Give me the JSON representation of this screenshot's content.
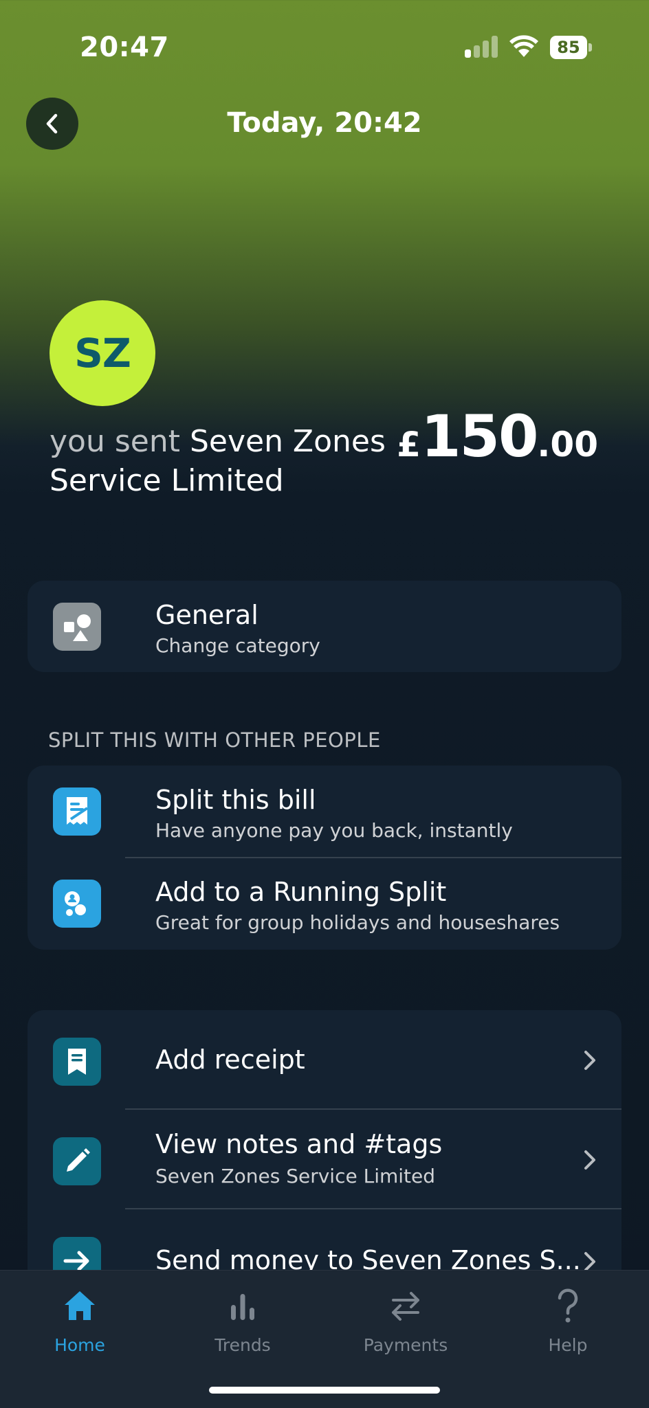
{
  "status_bar": {
    "time": "20:47",
    "battery": "85"
  },
  "header": {
    "title": "Today, 20:42"
  },
  "merchant": {
    "initials": "SZ",
    "sent_prefix": "you sent ",
    "name": "Seven Zones Service Limited",
    "amount_currency": "£",
    "amount_whole": "150",
    "amount_decimal": ".00"
  },
  "category": {
    "title": "General",
    "subtitle": "Change category"
  },
  "split_section": {
    "heading": "SPLIT THIS WITH OTHER PEOPLE",
    "items": [
      {
        "title": "Split this bill",
        "subtitle": "Have anyone pay you back, instantly"
      },
      {
        "title": "Add to a Running Split",
        "subtitle": "Great for group holidays and houseshares"
      }
    ]
  },
  "actions": {
    "items": [
      {
        "title": "Add receipt"
      },
      {
        "title": "View notes and #tags",
        "subtitle": "Seven Zones Service Limited"
      },
      {
        "title": "Send money to Seven Zones S..."
      }
    ]
  },
  "tabbar": {
    "tabs": [
      {
        "label": "Home",
        "icon": "home-icon",
        "active": true
      },
      {
        "label": "Trends",
        "icon": "trends-icon",
        "active": false
      },
      {
        "label": "Payments",
        "icon": "payments-icon",
        "active": false
      },
      {
        "label": "Help",
        "icon": "help-icon",
        "active": false
      }
    ]
  },
  "colors": {
    "accent": "#2ba3e0",
    "avatar_bg": "#c4f03a",
    "card_bg": "#142231",
    "tabbar_bg": "#1c2733"
  }
}
